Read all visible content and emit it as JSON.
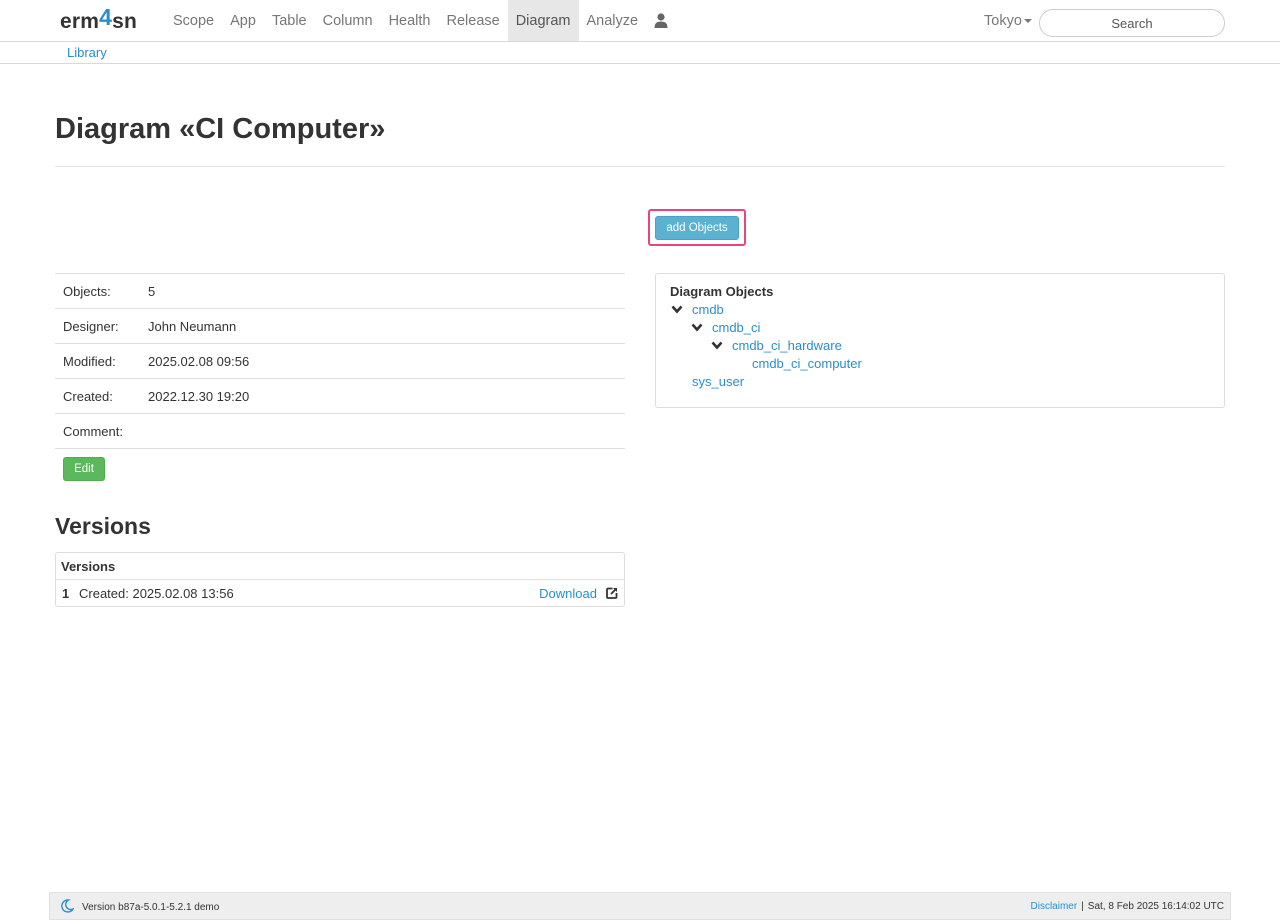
{
  "nav": {
    "brand_pre": "erm",
    "brand_four": "4",
    "brand_post": "sn",
    "items": [
      "Scope",
      "App",
      "Table",
      "Column",
      "Health",
      "Release",
      "Diagram",
      "Analyze"
    ],
    "active": "Diagram",
    "user_icon": "user-icon",
    "region": "Tokyo",
    "search_placeholder": "Search"
  },
  "subnav": {
    "library": "Library"
  },
  "page": {
    "title": "Diagram «CI Computer»",
    "add_objects": "add Objects"
  },
  "info": {
    "rows": [
      {
        "label": "Objects:",
        "value": "5"
      },
      {
        "label": "Designer:",
        "value": "John Neumann"
      },
      {
        "label": "Modified:",
        "value": "2025.02.08 09:56"
      },
      {
        "label": "Created:",
        "value": "2022.12.30 19:20"
      },
      {
        "label": "Comment:",
        "value": ""
      }
    ],
    "edit": "Edit"
  },
  "versions": {
    "title": "Versions",
    "panel_title": "Versions",
    "items": [
      {
        "number": "1",
        "created": "Created: 2025.02.08 13:56",
        "download": "Download",
        "icon": "external-link-icon"
      }
    ]
  },
  "objects": {
    "title": "Diagram Objects",
    "nodes": [
      {
        "label": "cmdb",
        "expanded": true
      },
      {
        "label": "cmdb_ci",
        "expanded": true
      },
      {
        "label": "cmdb_ci_hardware",
        "expanded": true
      },
      {
        "label": "cmdb_ci_computer",
        "expanded": false
      },
      {
        "label": "sys_user",
        "expanded": false
      }
    ]
  },
  "footer": {
    "icon": "moon-icon",
    "version": "Version b87a-5.0.1-5.2.1 demo",
    "disclaimer": "Disclaimer",
    "separator": "|",
    "timestamp": "Sat, 8 Feb 2025 16:14:02 UTC"
  },
  "colors": {
    "link": "#2a8fc9",
    "add_button": "#5bb1d0",
    "edit_button": "#5cb85c",
    "highlight": "#e8457c"
  }
}
